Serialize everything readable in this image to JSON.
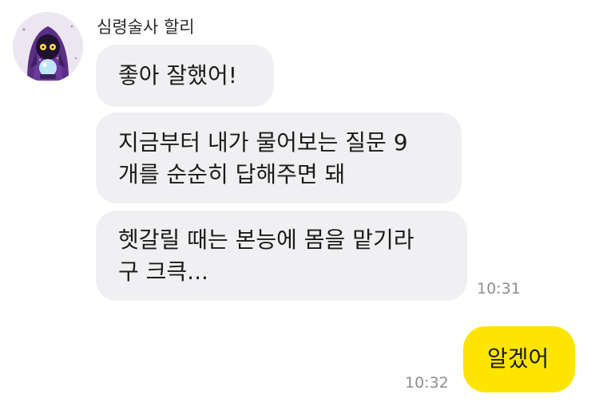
{
  "chat": {
    "sender_name": "심령술사 할리",
    "avatar_icon": "fortune-teller-avatar-icon",
    "colors": {
      "incoming_bubble": "#f0f0f2",
      "outgoing_bubble": "#fee500",
      "timestamp": "#8e8e93"
    },
    "incoming": [
      {
        "lines": [
          "좋아 잘했어!"
        ]
      },
      {
        "lines": [
          "지금부터 내가 물어보는 질문 9",
          "개를 순순히 답해주면 돼"
        ]
      },
      {
        "lines": [
          "헷갈릴 때는 본능에 몸을 맡기라",
          "구 크큭..."
        ]
      }
    ],
    "incoming_time": "10:31",
    "outgoing": [
      {
        "lines": [
          "알겠어"
        ]
      }
    ],
    "outgoing_time": "10:32"
  }
}
